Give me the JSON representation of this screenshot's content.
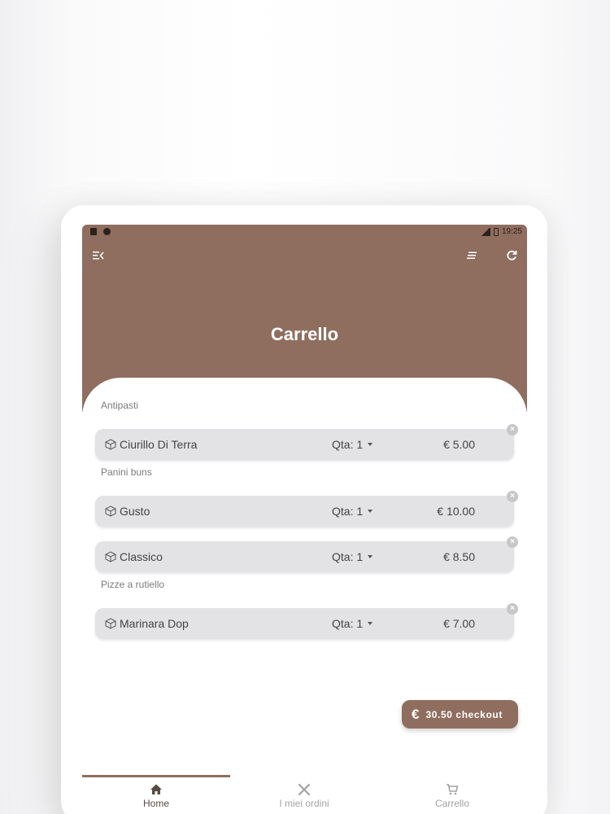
{
  "app": {
    "title": "Carrello",
    "status_bar": {
      "time": "19:25"
    },
    "colors": {
      "accent": "#8f6e5f",
      "item_bg": "#e3e2e4"
    }
  },
  "header": {
    "icons": [
      "menu-collapse-icon",
      "list-icon",
      "refresh-icon"
    ]
  },
  "sections": [
    {
      "label": "Antipasti"
    },
    {
      "label": "Panini buns"
    },
    {
      "label": "Pizze a rutiello"
    }
  ],
  "items": [
    {
      "name": "Ciurillo Di Terra",
      "qty_label": "Qta: 1",
      "price": "€  5.00"
    },
    {
      "name": "Gusto",
      "qty_label": "Qta: 1",
      "price": "€  10.00"
    },
    {
      "name": "Classico",
      "qty_label": "Qta: 1",
      "price": "€  8.50"
    },
    {
      "name": "Marinara Dop",
      "qty_label": "Qta: 1",
      "price": "€  7.00"
    }
  ],
  "checkout": {
    "currency": "€",
    "label": "30.50 checkout"
  },
  "bottom_nav": [
    {
      "label": "Home",
      "icon": "home-icon",
      "active": true
    },
    {
      "label": "I miei ordini",
      "icon": "utensils-icon",
      "active": false
    },
    {
      "label": "Carrello",
      "icon": "cart-icon",
      "active": false
    }
  ]
}
